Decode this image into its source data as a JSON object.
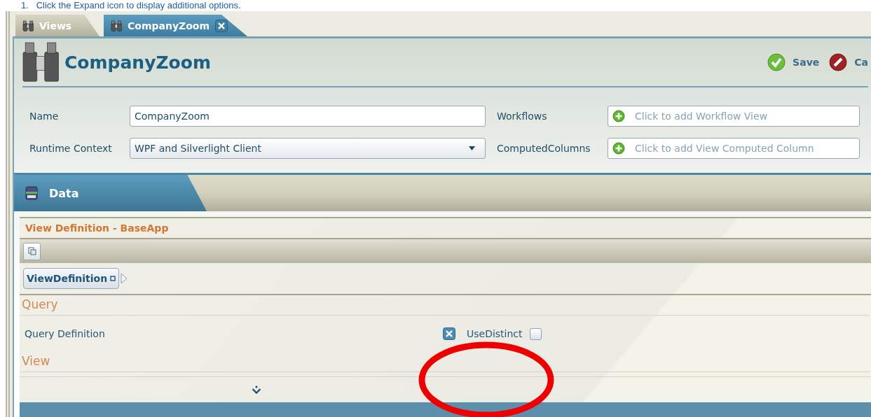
{
  "instruction": {
    "number": "1.",
    "text": "Click the Expand icon to display additional options."
  },
  "tabs": [
    {
      "label": "Views",
      "selected": false,
      "closable": false
    },
    {
      "label": "CompanyZoom",
      "selected": true,
      "closable": true
    }
  ],
  "header": {
    "title": "CompanyZoom",
    "actions": [
      {
        "label": "Save",
        "kind": "save"
      },
      {
        "label": "Ca",
        "kind": "cancel"
      }
    ]
  },
  "form": {
    "name": {
      "label": "Name",
      "value": "CompanyZoom"
    },
    "runtime_context": {
      "label": "Runtime Context",
      "value": "WPF and Silverlight Client"
    },
    "workflows": {
      "label": "Workflows",
      "placeholder": "Click to add Workflow View"
    },
    "computed_columns": {
      "label": "ComputedColumns",
      "placeholder": "Click to add View Computed Column"
    }
  },
  "section": {
    "title": "Data"
  },
  "view_definition": {
    "title": "View Definition - BaseApp",
    "breadcrumb": "ViewDefinition",
    "groups": [
      {
        "title": "Query",
        "rows": [
          {
            "label": "Query Definition",
            "option_label": "UseDistinct",
            "checked": false
          }
        ]
      },
      {
        "title": "View"
      }
    ]
  }
}
